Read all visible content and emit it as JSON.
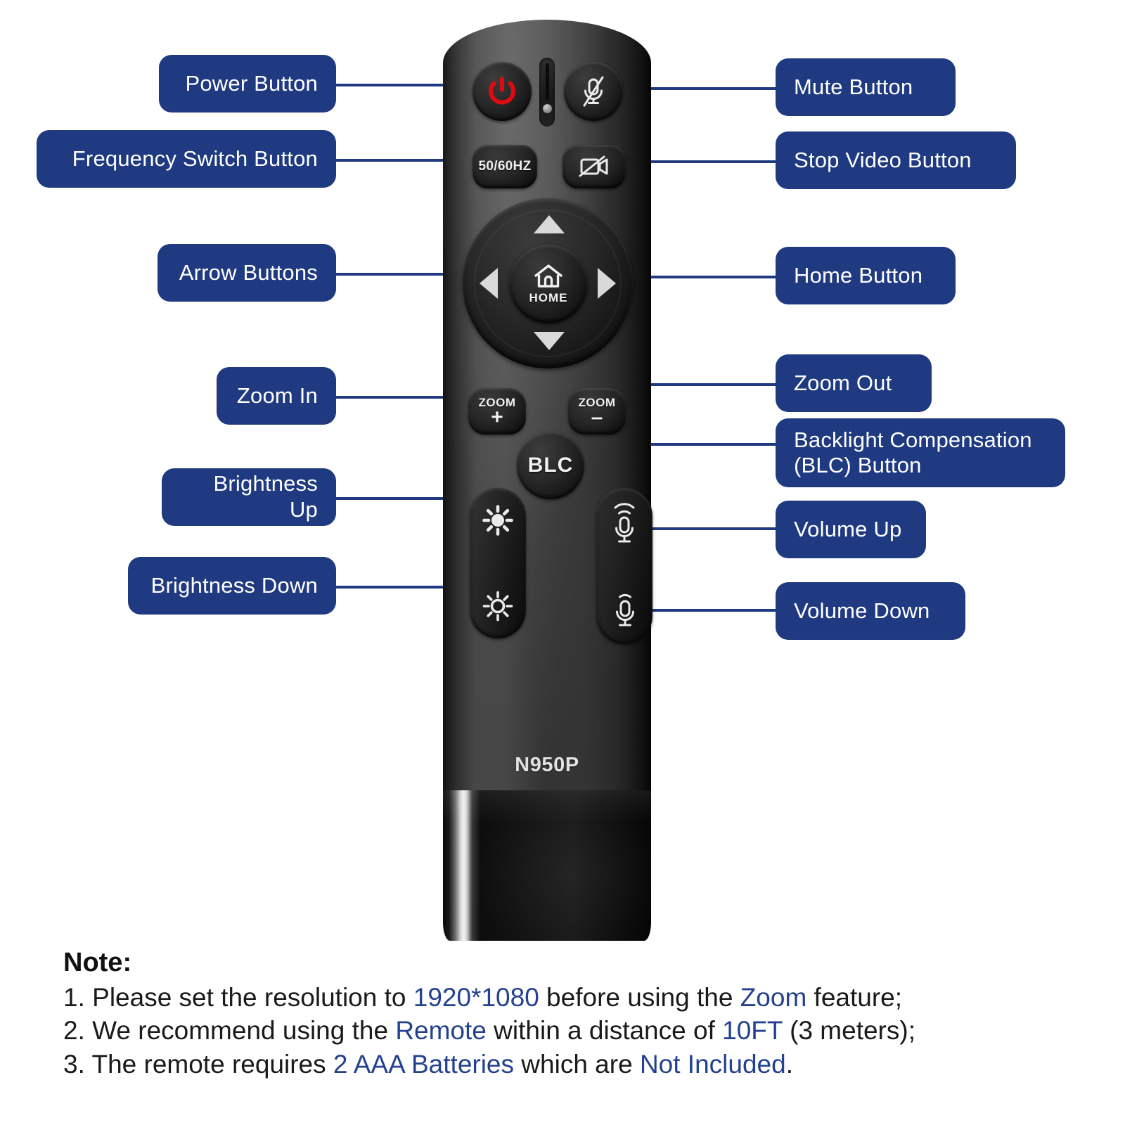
{
  "product": {
    "model_label": "N950P",
    "type": "remote-control-diagram"
  },
  "accent_colors": {
    "badge_blue": "#1f3a80",
    "line_blue": "#1f3a80",
    "highlight_blue": "#23418f",
    "power_red": "#dd0b12",
    "button_glyph": "#f0f0f0"
  },
  "callouts": {
    "left": [
      {
        "id": "power",
        "label": "Power Button",
        "icon": "power-icon"
      },
      {
        "id": "frequency",
        "label": "Frequency Switch Button",
        "icon": "50-60hz-icon"
      },
      {
        "id": "arrows",
        "label": "Arrow Buttons",
        "icon": "dpad-arrows-icon"
      },
      {
        "id": "zoom-in",
        "label": "Zoom In",
        "icon": "zoom-plus-icon"
      },
      {
        "id": "brightness-up",
        "label": "Brightness Up",
        "icon": "sun-filled-icon"
      },
      {
        "id": "brightness-down",
        "label": "Brightness Down",
        "icon": "sun-outline-icon"
      }
    ],
    "right": [
      {
        "id": "mute",
        "label": "Mute Button",
        "icon": "mic-muted-icon"
      },
      {
        "id": "stop-video",
        "label": "Stop Video Button",
        "icon": "camera-off-icon"
      },
      {
        "id": "home",
        "label": "Home Button",
        "icon": "home-icon"
      },
      {
        "id": "zoom-out",
        "label": "Zoom Out",
        "icon": "zoom-minus-icon"
      },
      {
        "id": "blc",
        "label": "Backlight Compensation (BLC) Button",
        "icon": "blc-icon",
        "label_line1": "Backlight Compensation",
        "label_line2": "(BLC) Button"
      },
      {
        "id": "volume-up",
        "label": "Volume Up",
        "icon": "mic-waves-icon"
      },
      {
        "id": "volume-down",
        "label": "Volume Down",
        "icon": "mic-icon"
      }
    ]
  },
  "remote_buttons": {
    "freq_label": "50/60HZ",
    "home_label": "HOME",
    "blc_label": "BLC",
    "zoom_word": "ZOOM",
    "zoom_in_sign": "+",
    "zoom_out_sign": "–"
  },
  "note": {
    "title": "Note:",
    "lines": [
      {
        "parts": [
          {
            "t": "1. Please set the resolution to ",
            "hl": false
          },
          {
            "t": "1920*1080",
            "hl": true
          },
          {
            "t": " before using the ",
            "hl": false
          },
          {
            "t": "Zoom",
            "hl": true
          },
          {
            "t": " feature;",
            "hl": false
          }
        ]
      },
      {
        "parts": [
          {
            "t": "2. We recommend using the ",
            "hl": false
          },
          {
            "t": "Remote",
            "hl": true
          },
          {
            "t": " within a distance of ",
            "hl": false
          },
          {
            "t": "10FT",
            "hl": true
          },
          {
            "t": " (3 meters);",
            "hl": false
          }
        ]
      },
      {
        "parts": [
          {
            "t": "3. The remote requires ",
            "hl": false
          },
          {
            "t": "2 AAA Batteries",
            "hl": true
          },
          {
            "t": " which are ",
            "hl": false
          },
          {
            "t": "Not Included",
            "hl": true
          },
          {
            "t": ".",
            "hl": false
          }
        ]
      }
    ]
  }
}
